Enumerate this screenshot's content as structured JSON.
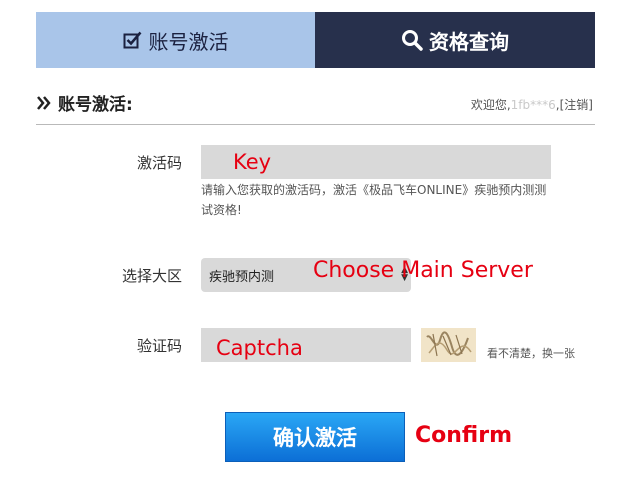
{
  "tabs": {
    "activate_label": "账号激活",
    "query_label": "资格查询"
  },
  "section": {
    "title": "账号激活:",
    "welcome_prefix": "欢迎您,",
    "username_masked": "1fb***6",
    "welcome_sep": ",",
    "logout": "[注销]"
  },
  "form": {
    "key_label": "激活码",
    "key_value": "Key",
    "key_hint": "请输入您获取的激活码，激活《极品飞车ONLINE》疾驰预内测测试资格!",
    "server_label": "选择大区",
    "server_selected": "疾驰预内测",
    "server_annotation": "Choose Main Server",
    "captcha_label": "验证码",
    "captcha_value": "Captcha",
    "captcha_refresh": "看不清楚，换一张",
    "confirm_label": "确认激活",
    "confirm_annotation": "Confirm"
  },
  "colors": {
    "tab_active_bg": "#a9c5e9",
    "tab_inactive_bg": "#27304c",
    "annotation_red": "#e60012",
    "button_blue": "#1b8ae6"
  },
  "icons": {
    "tab_activate": "checkbox-check-icon",
    "tab_query": "search-icon",
    "section_title": "double-chevron-right-icon",
    "select": "updown-arrows-icon"
  }
}
